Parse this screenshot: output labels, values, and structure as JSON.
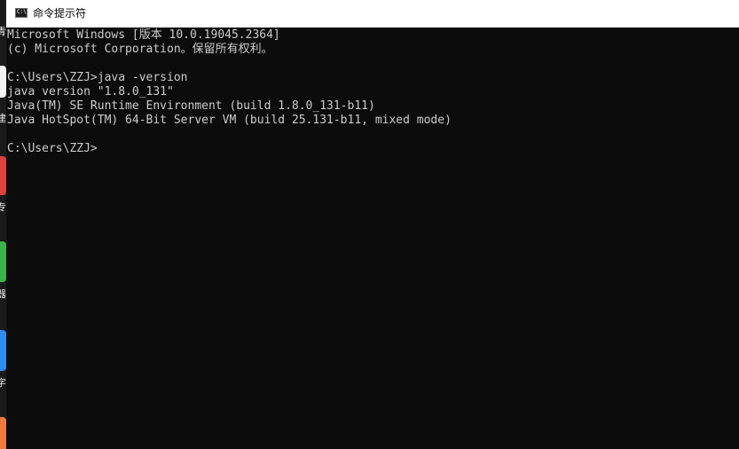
{
  "window": {
    "title": "命令提示符",
    "icon": "cmd-icon",
    "icon_glyph": "C:\\"
  },
  "desktop_strip": {
    "labels": [
      "青",
      "建",
      "专",
      "器",
      "字"
    ],
    "colors": {
      "icon_red": "#e0413c",
      "icon_green": "#3cb34a",
      "icon_blue": "#2d8cf0",
      "icon_orange": "#f07a3a",
      "icon_white": "#f2f2f2"
    }
  },
  "console": {
    "text_color": "#cccccc",
    "background": "#0c0c0c",
    "lines": [
      "Microsoft Windows [版本 10.0.19045.2364]",
      "(c) Microsoft Corporation。保留所有权利。",
      "",
      "C:\\Users\\ZZJ>java -version",
      "java version \"1.8.0_131\"",
      "Java(TM) SE Runtime Environment (build 1.8.0_131-b11)",
      "Java HotSpot(TM) 64-Bit Server VM (build 25.131-b11, mixed mode)",
      "",
      "C:\\Users\\ZZJ>"
    ]
  }
}
